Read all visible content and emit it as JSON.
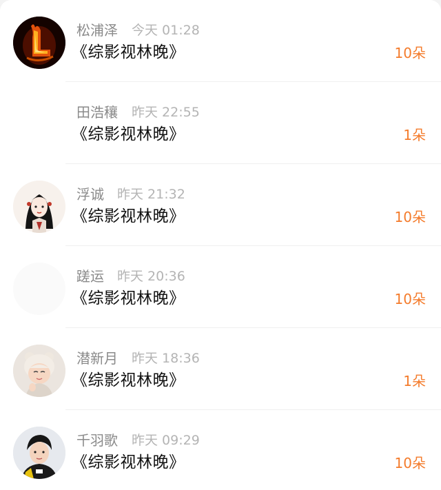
{
  "accent_color": "#f47b2b",
  "rows": [
    {
      "user": "松浦泽",
      "time": "今天 01:28",
      "title": "《综影视林晚》",
      "count": "10朵",
      "avatar": "fire-letter-l-avatar"
    },
    {
      "user": "田浩穰",
      "time": "昨天 22:55",
      "title": "《综影视林晚》",
      "count": "1朵",
      "avatar": "blank-avatar"
    },
    {
      "user": "浮诚",
      "time": "昨天 21:32",
      "title": "《综影视林晚》",
      "count": "10朵",
      "avatar": "anime-girl-avatar"
    },
    {
      "user": "蹉运",
      "time": "昨天 20:36",
      "title": "《综影视林晚》",
      "count": "10朵",
      "avatar": "blank-avatar"
    },
    {
      "user": "潜新月",
      "time": "昨天 18:36",
      "title": "《综影视林晚》",
      "count": "1朵",
      "avatar": "child-bear-hat-avatar"
    },
    {
      "user": "千羽歌",
      "time": "昨天 09:29",
      "title": "《综影视林晚》",
      "count": "10朵",
      "avatar": "boy-portrait-avatar"
    }
  ]
}
